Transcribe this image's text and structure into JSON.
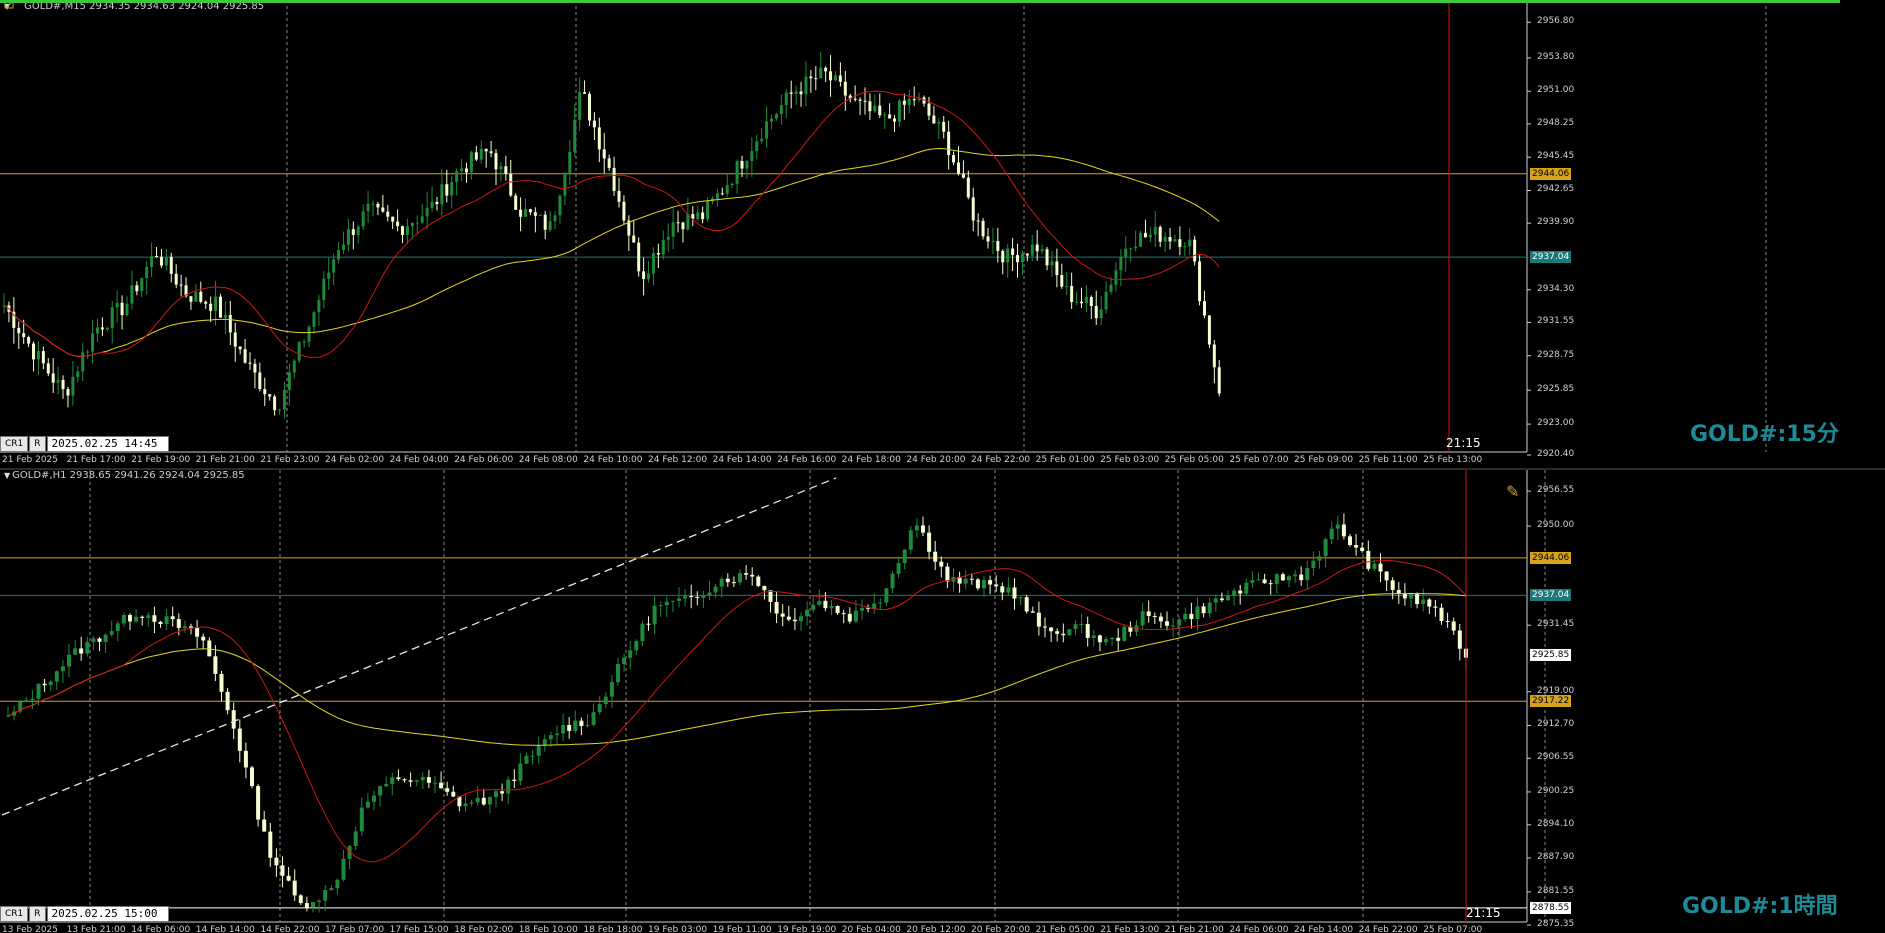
{
  "pane1": {
    "header": "GOLD#,M15  2934.35 2934.63 2924.04 2925.85",
    "watermark": "GOLD#:15分",
    "cr_label": "CR1",
    "r_label": "R",
    "time_box": "2025.02.25 14:45",
    "now_label": "21:15",
    "x_labels": [
      "21 Feb 2025",
      "21 Feb 17:00",
      "21 Feb 19:00",
      "21 Feb 21:00",
      "21 Feb 23:00",
      "24 Feb 02:00",
      "24 Feb 04:00",
      "24 Feb 06:00",
      "24 Feb 08:00",
      "24 Feb 10:00",
      "24 Feb 12:00",
      "24 Feb 14:00",
      "24 Feb 16:00",
      "24 Feb 18:00",
      "24 Feb 20:00",
      "24 Feb 22:00",
      "25 Feb 01:00",
      "25 Feb 03:00",
      "25 Feb 05:00",
      "25 Feb 07:00",
      "25 Feb 09:00",
      "25 Feb 11:00",
      "25 Feb 13:00"
    ],
    "y_labels": [
      "2956.80",
      "2953.80",
      "2951.00",
      "2948.25",
      "2945.45",
      "2942.65",
      "2939.90",
      "2934.30",
      "2931.55",
      "2928.75",
      "2925.85",
      "2923.00",
      "2920.40"
    ],
    "ylim": [
      2920.4,
      2958.0
    ],
    "hlines": [
      {
        "price": 2944.06,
        "label": "2944.06",
        "color": "#d9a21b",
        "text_color": "#000000"
      },
      {
        "price": 2937.04,
        "label": "2937.04",
        "color": "#1a7a7a",
        "text_color": "#ffffff"
      }
    ]
  },
  "pane2": {
    "header": "GOLD#,H1  2938.65 2941.26 2924.04 2925.85",
    "watermark": "GOLD#:1時間",
    "cr_label": "CR1",
    "r_label": "R",
    "time_box": "2025.02.25 15:00",
    "now_label": "21:15",
    "x_labels": [
      "13 Feb 2025",
      "13 Feb 21:00",
      "14 Feb 06:00",
      "14 Feb 14:00",
      "14 Feb 22:00",
      "17 Feb 07:00",
      "17 Feb 15:00",
      "18 Feb 02:00",
      "18 Feb 10:00",
      "18 Feb 18:00",
      "19 Feb 03:00",
      "19 Feb 11:00",
      "19 Feb 19:00",
      "20 Feb 04:00",
      "20 Feb 12:00",
      "20 Feb 20:00",
      "21 Feb 05:00",
      "21 Feb 13:00",
      "21 Feb 21:00",
      "24 Feb 06:00",
      "24 Feb 14:00",
      "24 Feb 22:00",
      "25 Feb 07:00"
    ],
    "y_labels": [
      "2956.55",
      "2950.00",
      "2931.45",
      "2919.00",
      "2912.70",
      "2906.55",
      "2900.25",
      "2894.10",
      "2887.90",
      "2881.55",
      "2875.35"
    ],
    "ylim": [
      2875.35,
      2959.0
    ],
    "hlines": [
      {
        "price": 2944.06,
        "label": "2944.06",
        "color": "#d9a21b",
        "text_color": "#000000"
      },
      {
        "price": 2937.04,
        "label": "2937.04",
        "color": "#1a7a7a",
        "text_color": "#ffffff"
      },
      {
        "price": 2925.85,
        "label": "2925.85",
        "color": "#ffffff",
        "text_color": "#000000",
        "badge_only": true
      },
      {
        "price": 2917.22,
        "label": "2917.22",
        "color": "#d9a21b",
        "text_color": "#000000"
      },
      {
        "price": 2878.55,
        "label": "2878.55",
        "color": "#ffffff",
        "text_color": "#000000"
      }
    ]
  },
  "colors": {
    "bull": "#1f8a3a",
    "bear": "#f4ffcf",
    "ma_fast": "#d01515",
    "ma_slow": "#e0d823",
    "now_line": "#d01515",
    "grid": "#8a8a8a",
    "top_bar": "#3cc83c",
    "watermark": "#1e8a97"
  },
  "pane1_badge_current": "2925.85"
}
